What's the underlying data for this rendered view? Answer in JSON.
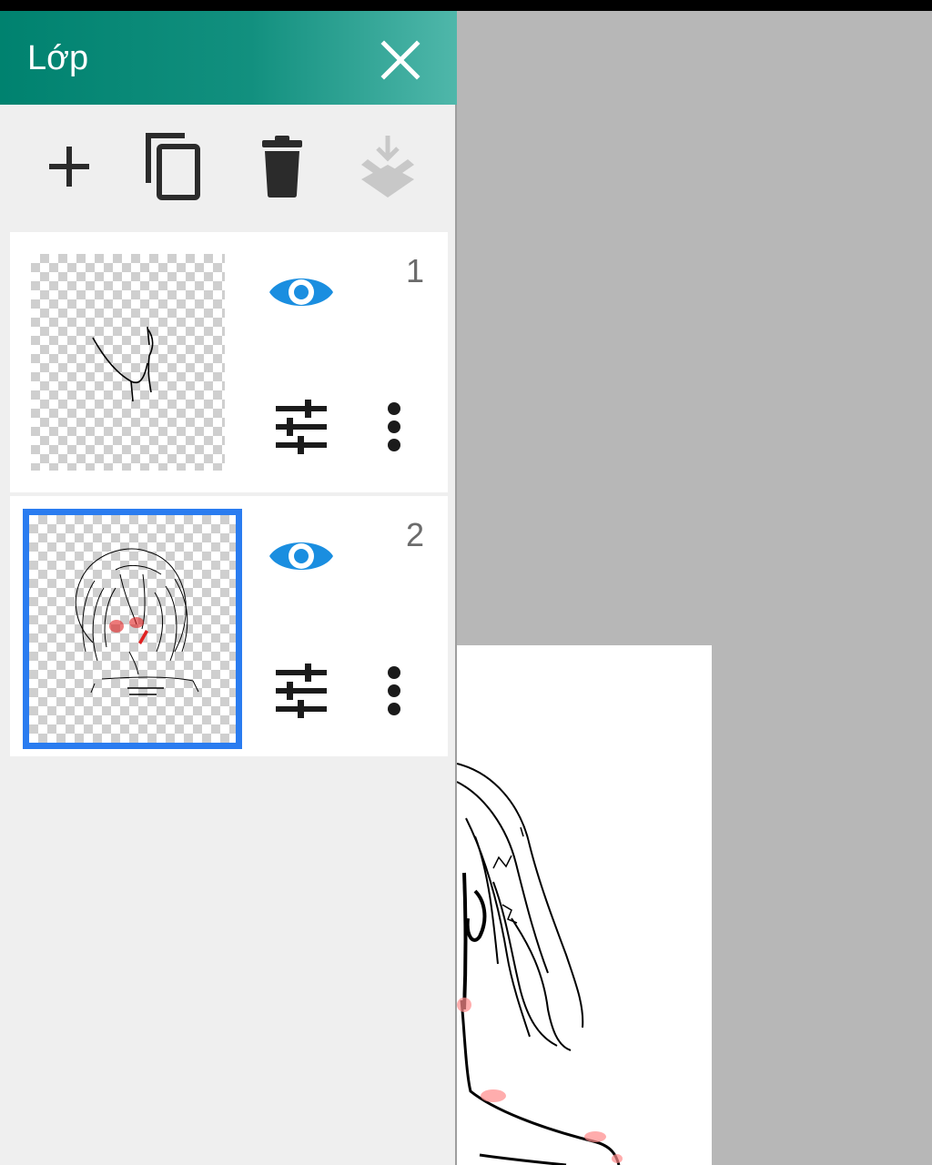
{
  "panel": {
    "title": "Lớp",
    "close_icon": "close-icon"
  },
  "toolbar": {
    "icons": [
      "add-layer-icon",
      "duplicate-layer-icon",
      "delete-layer-icon",
      "merge-down-icon"
    ],
    "merge_down_enabled": false
  },
  "layers": [
    {
      "number": "1",
      "visible": true,
      "selected": false
    },
    {
      "number": "2",
      "visible": true,
      "selected": true
    }
  ],
  "colors": {
    "header_start": "#00826f",
    "header_end": "#4fb7aa",
    "accent_blue": "#1a8ee0",
    "selection_blue": "#2a7cf0"
  }
}
